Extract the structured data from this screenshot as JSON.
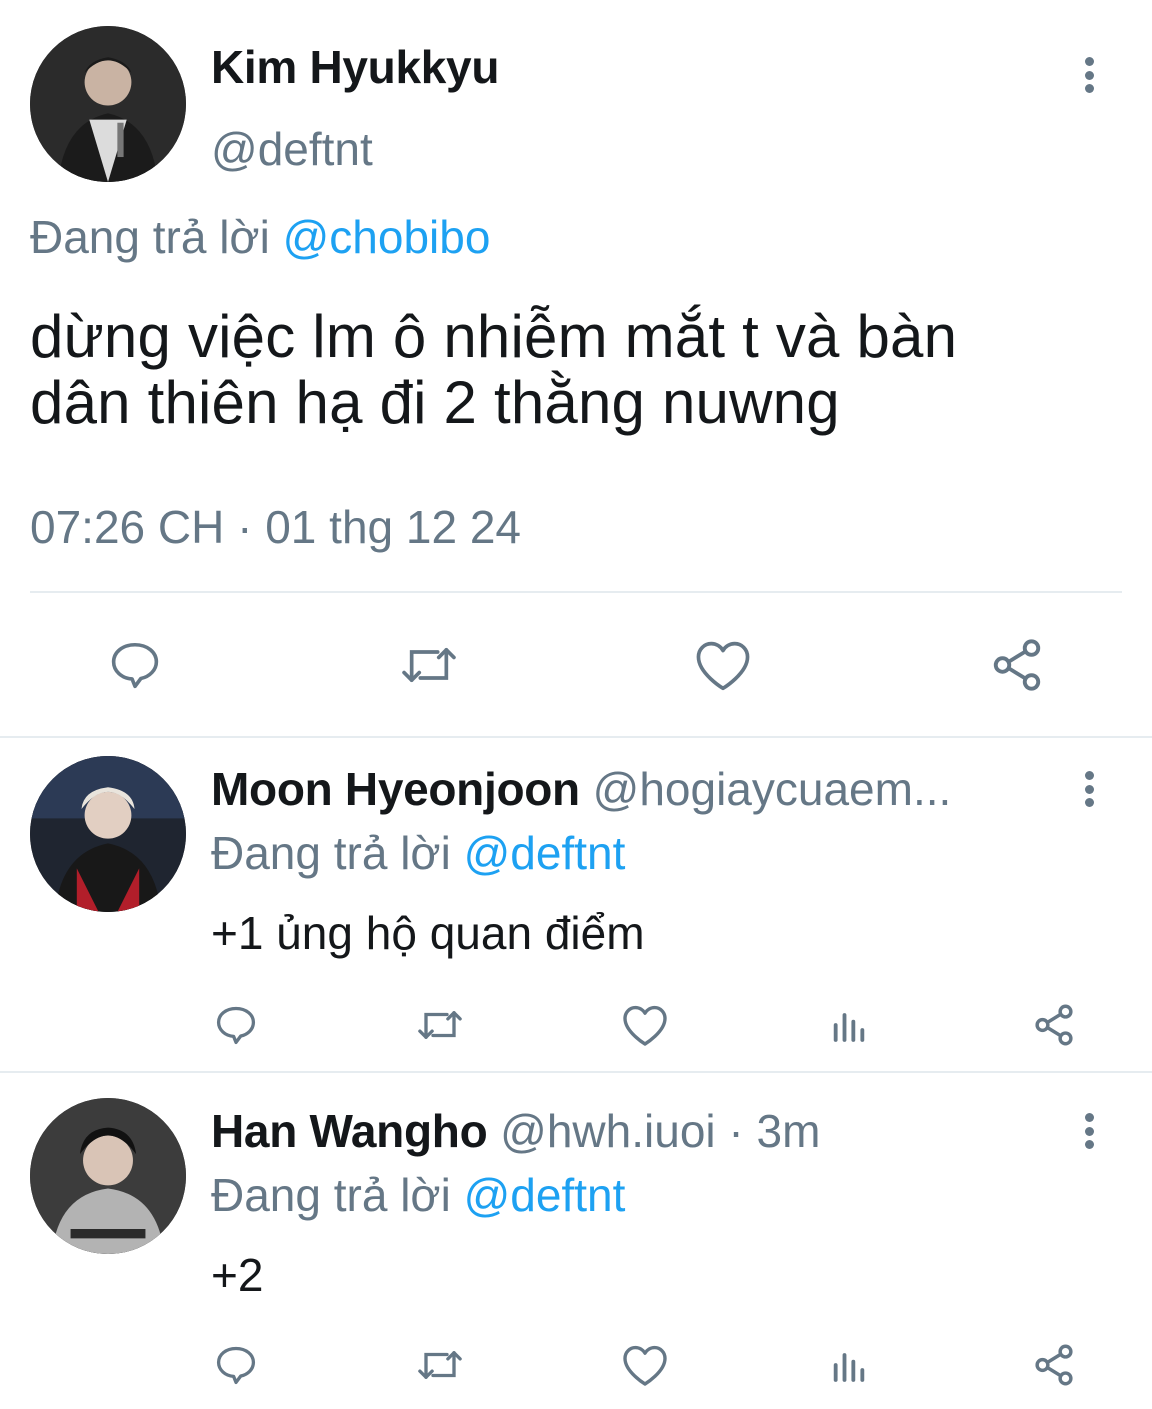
{
  "main_tweet": {
    "author_name": "Kim Hyukkyu",
    "author_handle": "@deftnt",
    "replying_prefix": "Đang trả lời ",
    "replying_to": "@chobibo",
    "text_line1": "dừng việc lm ô nhiễm mắt t và bàn",
    "text_line2": "dân thiên hạ đi 2 thằng nuwng",
    "timestamp": "07:26 CH · 01 thg 12 24",
    "actions": [
      "reply-icon",
      "retweet-icon",
      "like-icon",
      "share-icon"
    ]
  },
  "replies": [
    {
      "author_name": "Moon Hyeonjoon",
      "author_handle": "@hogiaycuaem...",
      "replying_prefix": "Đang trả lời ",
      "replying_to": "@deftnt",
      "text": "+1 ủng hộ quan điểm",
      "actions": [
        "reply-icon",
        "retweet-icon",
        "like-icon",
        "analytics-icon",
        "share-icon"
      ]
    },
    {
      "author_name": "Han Wangho",
      "author_handle": "@hwh.iuoi · 3m",
      "replying_prefix": "Đang trả lời ",
      "replying_to": "@deftnt",
      "text": "+2",
      "actions": [
        "reply-icon",
        "retweet-icon",
        "like-icon",
        "analytics-icon",
        "share-icon"
      ]
    }
  ],
  "colors": {
    "text": "#14171a",
    "secondary": "#657786",
    "link": "#1da1f2",
    "divider": "#e6ecf0"
  }
}
